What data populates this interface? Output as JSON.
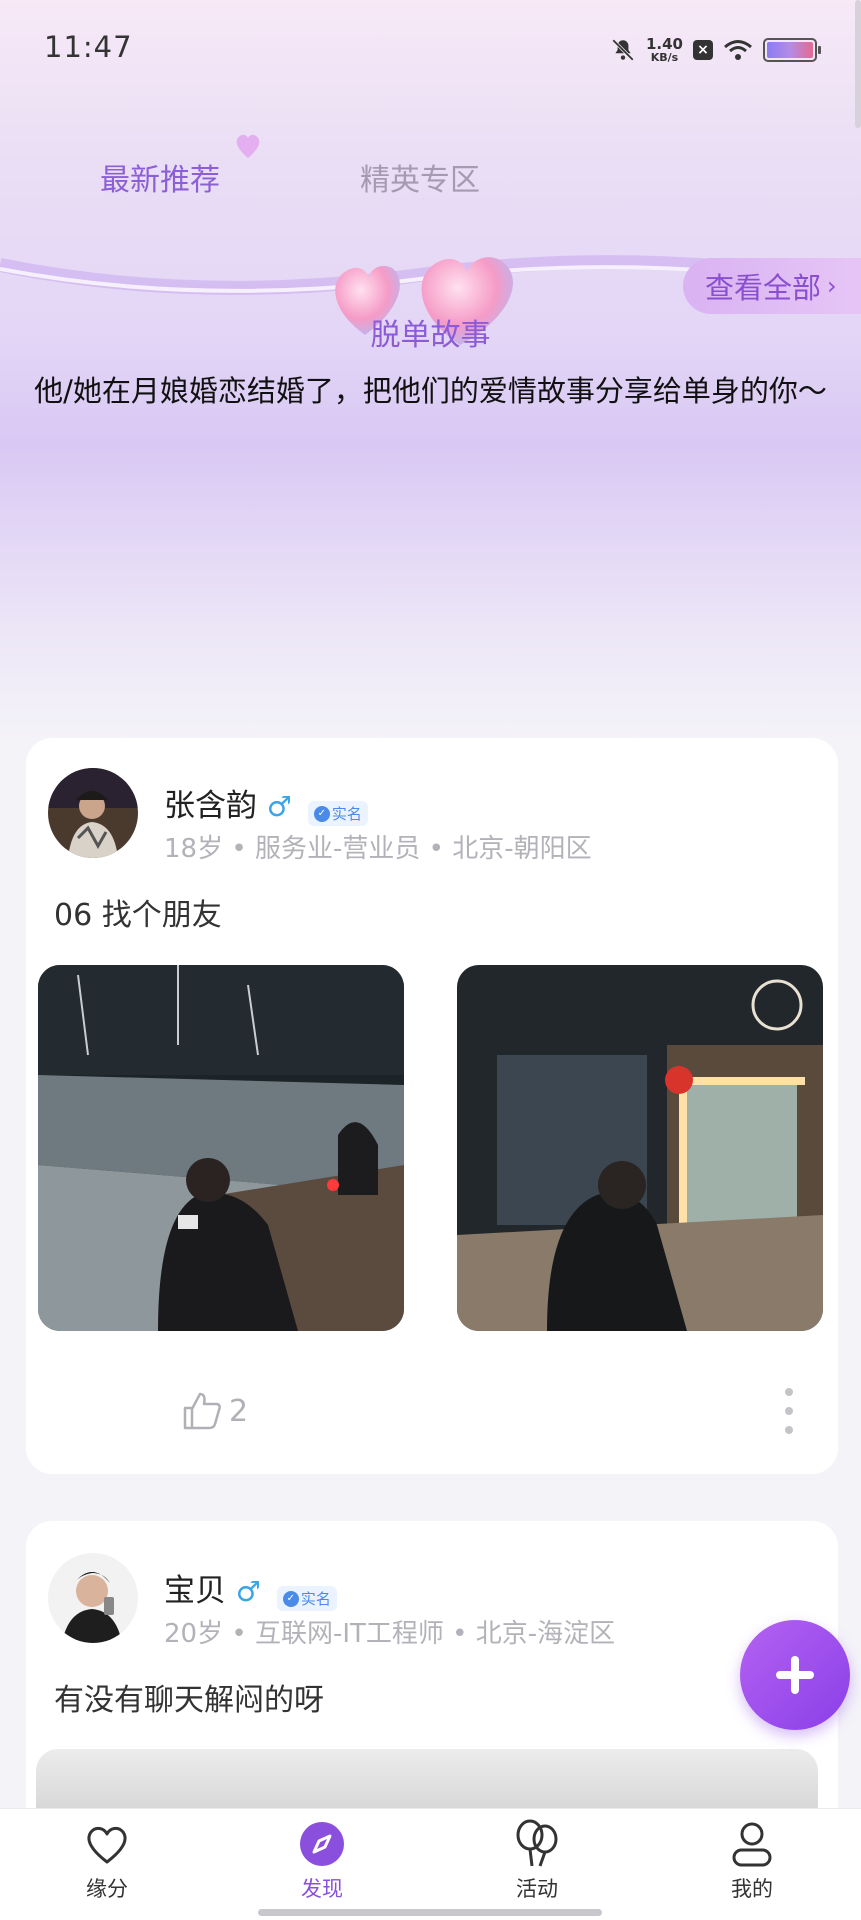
{
  "status_bar": {
    "time": "11:47",
    "net_speed": "1.40",
    "net_unit": "KB/s"
  },
  "tabs": [
    {
      "label": "最新推荐",
      "active": true
    },
    {
      "label": "精英专区",
      "active": false
    }
  ],
  "banner": {
    "view_all": "查看全部",
    "title": "脱单故事",
    "subtitle": "他/她在月娘婚恋结婚了，把他们的爱情故事分享给单身的你～"
  },
  "posts": [
    {
      "name": "张含韵",
      "gender_symbol": "♂",
      "verified_label": "实名",
      "meta": "18岁 • 服务业-营业员 • 北京-朝阳区",
      "text": "06 找个朋友",
      "likes": "2"
    },
    {
      "name": "宝贝",
      "gender_symbol": "♂",
      "verified_label": "实名",
      "meta": "20岁 • 互联网-IT工程师 • 北京-海淀区",
      "text": "有没有聊天解闷的呀"
    }
  ],
  "bottom_nav": [
    {
      "label": "缘分",
      "icon": "heart-icon"
    },
    {
      "label": "发现",
      "icon": "compass-icon",
      "active": true
    },
    {
      "label": "活动",
      "icon": "balloons-icon"
    },
    {
      "label": "我的",
      "icon": "person-icon"
    }
  ],
  "colors": {
    "accent": "#8a4fdc",
    "male": "#3aa4e8",
    "verify": "#4b8be8"
  }
}
